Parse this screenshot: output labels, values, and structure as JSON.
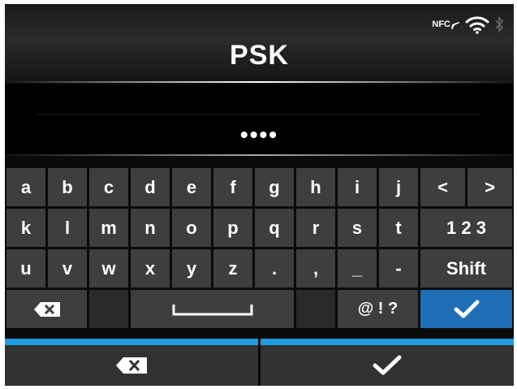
{
  "header": {
    "title": "PSK",
    "status_icons": [
      "nfc-icon",
      "wifi-icon",
      "bluetooth-icon"
    ],
    "nfc_label": "NFC"
  },
  "input": {
    "masked_value": "••••"
  },
  "keyboard": {
    "row1": [
      "a",
      "b",
      "c",
      "d",
      "e",
      "f",
      "g",
      "h",
      "i",
      "j"
    ],
    "row1_nav": [
      "<",
      ">"
    ],
    "row2": [
      "k",
      "l",
      "m",
      "n",
      "o",
      "p",
      "q",
      "r",
      "s",
      "t"
    ],
    "row2_mode": "1 2 3",
    "row3": [
      "u",
      "v",
      "w",
      "x",
      "y",
      "z",
      ".",
      ",",
      "_",
      "-"
    ],
    "row3_shift": "Shift",
    "row4_symbols": "@ ! ?",
    "row4_icons": [
      "backspace-icon",
      "space-icon",
      "checkmark-icon"
    ]
  },
  "bottom_bar": {
    "icons": [
      "backspace-icon",
      "checkmark-icon"
    ]
  },
  "colors": {
    "accent": "#1d9be0",
    "enter_key": "#1e6fb5",
    "key": "#3e3e3e"
  }
}
